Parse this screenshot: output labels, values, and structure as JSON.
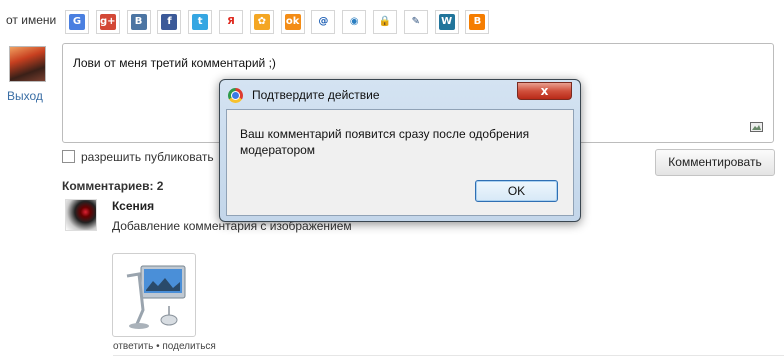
{
  "from_label": "от имени",
  "social": [
    {
      "name": "google-icon",
      "glyph": "G",
      "color": "#4a7fe0"
    },
    {
      "name": "google-plus-icon",
      "glyph": "g+",
      "color": "#d34836"
    },
    {
      "name": "vkontakte-icon",
      "glyph": "B",
      "color": "#4c75a3"
    },
    {
      "name": "facebook-icon",
      "glyph": "f",
      "color": "#3b5998"
    },
    {
      "name": "twitter-icon",
      "glyph": "t",
      "color": "#35a6e2"
    },
    {
      "name": "yandex-icon",
      "glyph": "Я",
      "color": "#ffffff",
      "fg": "#e02b20"
    },
    {
      "name": "mail-agent-icon",
      "glyph": "✿",
      "color": "#f4a623"
    },
    {
      "name": "odnoklassniki-icon",
      "glyph": "ok",
      "color": "#f38c16"
    },
    {
      "name": "mail-ru-icon",
      "glyph": "@",
      "color": "#ffffff",
      "fg": "#1d5fb5"
    },
    {
      "name": "rambler-icon",
      "glyph": "◉",
      "color": "#ffffff",
      "fg": "#2b7ec1"
    },
    {
      "name": "lock-icon",
      "glyph": "🔒",
      "color": "#ffffff",
      "fg": "#444"
    },
    {
      "name": "livejournal-icon",
      "glyph": "✎",
      "color": "#ffffff",
      "fg": "#2c4f7c"
    },
    {
      "name": "wordpress-icon",
      "glyph": "W",
      "color": "#21759b"
    },
    {
      "name": "blogger-icon",
      "glyph": "B",
      "color": "#f57d00"
    }
  ],
  "user": {
    "logout_label": "Выход"
  },
  "comment_form": {
    "text": "Лови от меня третий комментарий ;)",
    "allow_label": "разрешить публиковать",
    "submit_label": "Комментировать"
  },
  "comments": {
    "count_label": "Комментариев: 2",
    "items": [
      {
        "author": "Ксения",
        "text": "Добавление комментария с изображением",
        "actions": "ответить • поделиться"
      }
    ]
  },
  "dialog": {
    "title": "Подтвердите действие",
    "message": "Ваш комментарий появится сразу после одобрения модератором",
    "ok_label": "OK",
    "close_glyph": "x"
  }
}
